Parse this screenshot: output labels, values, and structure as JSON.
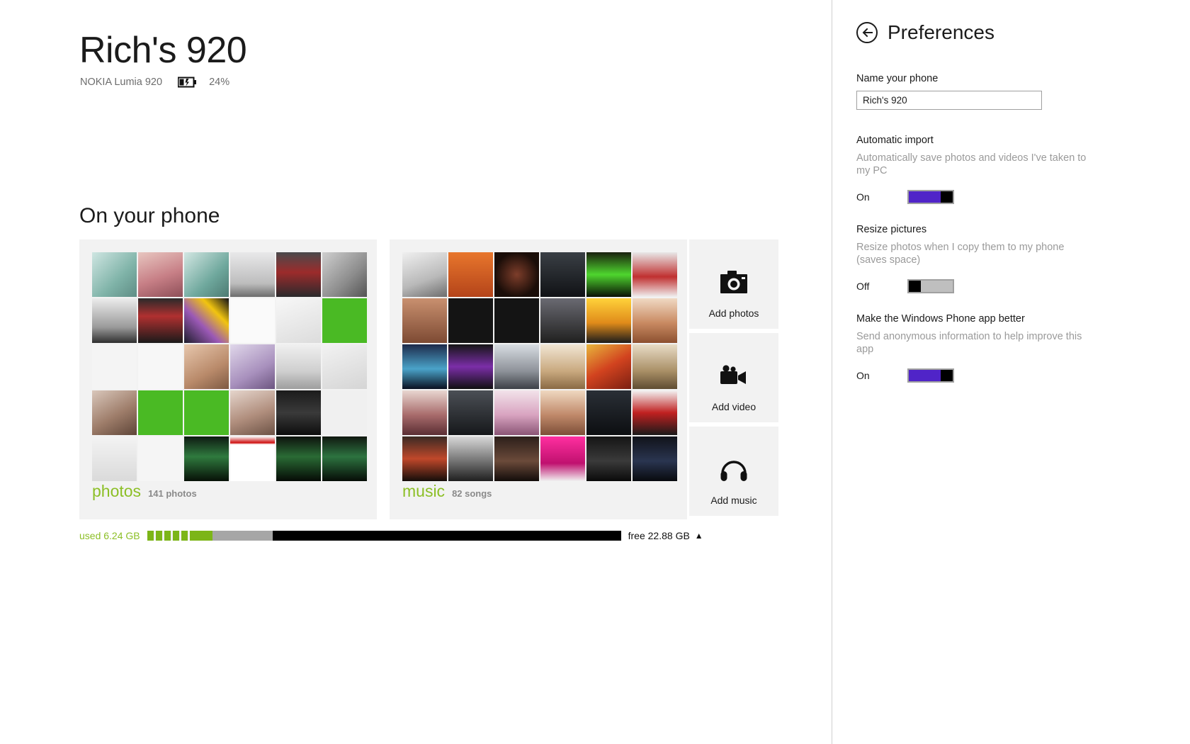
{
  "top_dots": {
    "count": 4,
    "color": "#3b1a9c",
    "positions": [
      277,
      435,
      537,
      612
    ]
  },
  "device": {
    "name": "Rich's 920",
    "model": "NOKIA Lumia 920",
    "battery_percent": "24%",
    "battery_icon": "battery-charging-icon"
  },
  "section": {
    "title": "On your phone"
  },
  "tiles": [
    {
      "id": "photos",
      "label": "photos",
      "count_text": "141 photos",
      "label_color": "#8cbf26"
    },
    {
      "id": "music",
      "label": "music",
      "count_text": "82 songs",
      "label_color": "#8cbf26"
    }
  ],
  "add_buttons": [
    {
      "id": "add-photos",
      "label": "Add photos",
      "icon": "camera-icon"
    },
    {
      "id": "add-video",
      "label": "Add video",
      "icon": "video-camera-icon"
    },
    {
      "id": "add-music",
      "label": "Add music",
      "icon": "headphones-icon"
    }
  ],
  "storage": {
    "used_label": "used 6.24 GB",
    "free_label": "free 22.88 GB",
    "expand_icon": "caret-up-icon",
    "used_color": "#8cbf26",
    "free_color": "#111111"
  },
  "preferences": {
    "back_icon": "back-arrow-icon",
    "title": "Preferences",
    "name_field": {
      "label": "Name your phone",
      "value": "Rich's 920",
      "placeholder": "Name your phone"
    },
    "settings": [
      {
        "id": "automatic-import",
        "title": "Automatic import",
        "description": "Automatically save photos and videos I've taken to my PC",
        "state_label": "On",
        "state": "on"
      },
      {
        "id": "resize-pictures",
        "title": "Resize pictures",
        "description": "Resize photos when I copy them to my phone (saves space)",
        "state_label": "Off",
        "state": "off"
      },
      {
        "id": "improve-app",
        "title": "Make the Windows Phone app better",
        "description": "Send anonymous information to help improve this app",
        "state_label": "On",
        "state": "on"
      }
    ],
    "accent_color": "#5024c8"
  }
}
